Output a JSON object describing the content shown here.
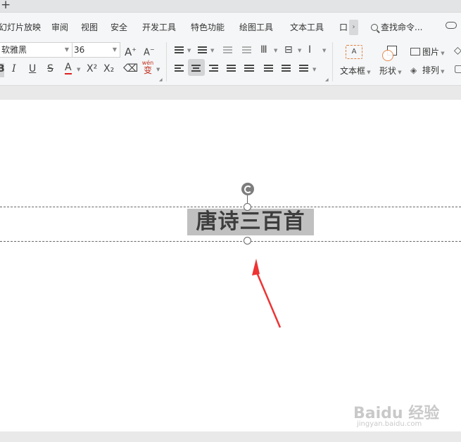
{
  "topbar": {
    "new_tab": "+"
  },
  "menu": {
    "items": [
      "幻灯片放映",
      "审阅",
      "视图",
      "安全",
      "开发工具",
      "特色功能",
      "绘图工具",
      "文本工具",
      "口"
    ],
    "more": "›",
    "search_placeholder": "查找命令..."
  },
  "toolbar": {
    "font_name": "软雅黑",
    "font_size": "36",
    "bold": "B",
    "italic": "I",
    "underline": "U",
    "strike": "S",
    "font_color": "A",
    "superscript": "X²",
    "subscript": "X₂",
    "phonetic": "wén",
    "phonetic_char": "变",
    "grow_font": "A",
    "shrink_font": "A",
    "textbox_label": "文本框",
    "shape_label": "形状",
    "picture_label": "图片",
    "arrange_label": "排列",
    "font_color_hex": "#e02020"
  },
  "slide": {
    "title": "唐诗三百首"
  },
  "watermark": {
    "brand": "Baidu 经验",
    "url": "jingyan.baidu.com"
  }
}
